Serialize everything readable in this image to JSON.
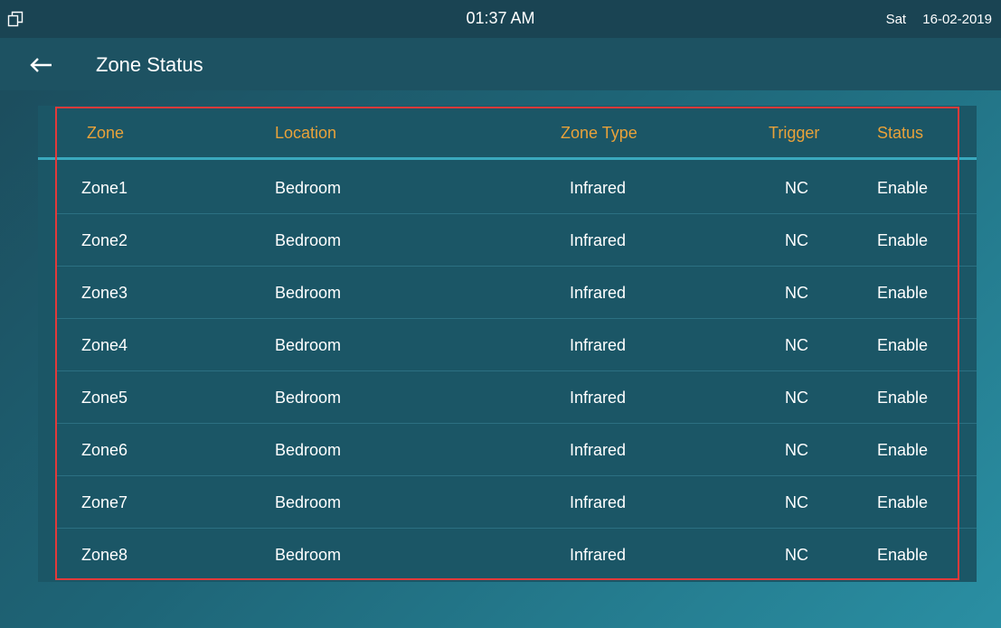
{
  "status_bar": {
    "icon": "window-restore-icon",
    "time": "01:37 AM",
    "day": "Sat",
    "date": "16-02-2019"
  },
  "title_bar": {
    "back_icon": "arrow-left-icon",
    "title": "Zone Status"
  },
  "table": {
    "headers": {
      "zone": "Zone",
      "location": "Location",
      "zone_type": "Zone Type",
      "trigger": "Trigger",
      "status": "Status"
    },
    "rows": [
      {
        "zone": "Zone1",
        "location": "Bedroom",
        "zone_type": "Infrared",
        "trigger": "NC",
        "status": "Enable"
      },
      {
        "zone": "Zone2",
        "location": "Bedroom",
        "zone_type": "Infrared",
        "trigger": "NC",
        "status": "Enable"
      },
      {
        "zone": "Zone3",
        "location": "Bedroom",
        "zone_type": "Infrared",
        "trigger": "NC",
        "status": "Enable"
      },
      {
        "zone": "Zone4",
        "location": "Bedroom",
        "zone_type": "Infrared",
        "trigger": "NC",
        "status": "Enable"
      },
      {
        "zone": "Zone5",
        "location": "Bedroom",
        "zone_type": "Infrared",
        "trigger": "NC",
        "status": "Enable"
      },
      {
        "zone": "Zone6",
        "location": "Bedroom",
        "zone_type": "Infrared",
        "trigger": "NC",
        "status": "Enable"
      },
      {
        "zone": "Zone7",
        "location": "Bedroom",
        "zone_type": "Infrared",
        "trigger": "NC",
        "status": "Enable"
      },
      {
        "zone": "Zone8",
        "location": "Bedroom",
        "zone_type": "Infrared",
        "trigger": "NC",
        "status": "Enable"
      }
    ]
  },
  "colors": {
    "header_text": "#e8a23a",
    "highlight_border": "#e23a3a",
    "accent_line": "#3aa8bd"
  }
}
